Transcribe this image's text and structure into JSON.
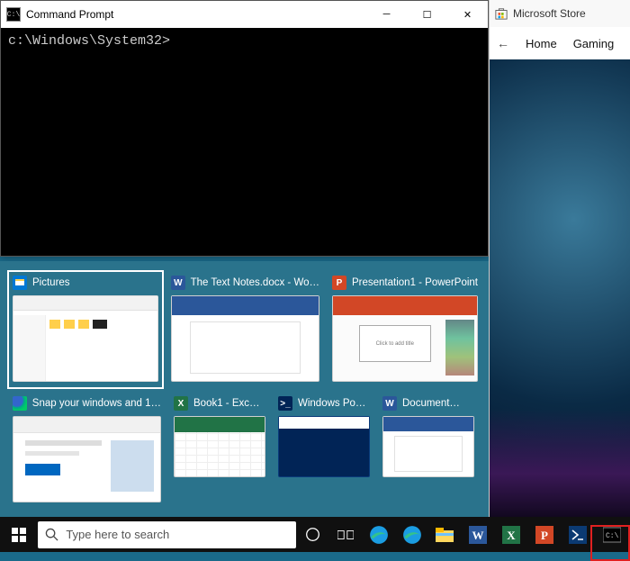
{
  "cmd": {
    "title": "Command Prompt",
    "prompt": "c:\\Windows\\System32>"
  },
  "store": {
    "title": "Microsoft Store",
    "nav": {
      "home": "Home",
      "gaming": "Gaming"
    }
  },
  "snap": {
    "tiles": [
      {
        "label": "Pictures"
      },
      {
        "label": "The Text Notes.docx - Wo…"
      },
      {
        "label": "Presentation1 - PowerPoint"
      },
      {
        "label": "Snap your windows and 1…"
      },
      {
        "label": "Book1 - Exc…"
      },
      {
        "label": "Windows Po…"
      },
      {
        "label": "Document…"
      }
    ],
    "ppt_placeholder": "Click to add title"
  },
  "taskbar": {
    "search_placeholder": "Type here to search"
  },
  "icons": {
    "cmd": "C:\\",
    "word": "W",
    "ppt": "P",
    "excel": "X",
    "ps": ">_"
  }
}
